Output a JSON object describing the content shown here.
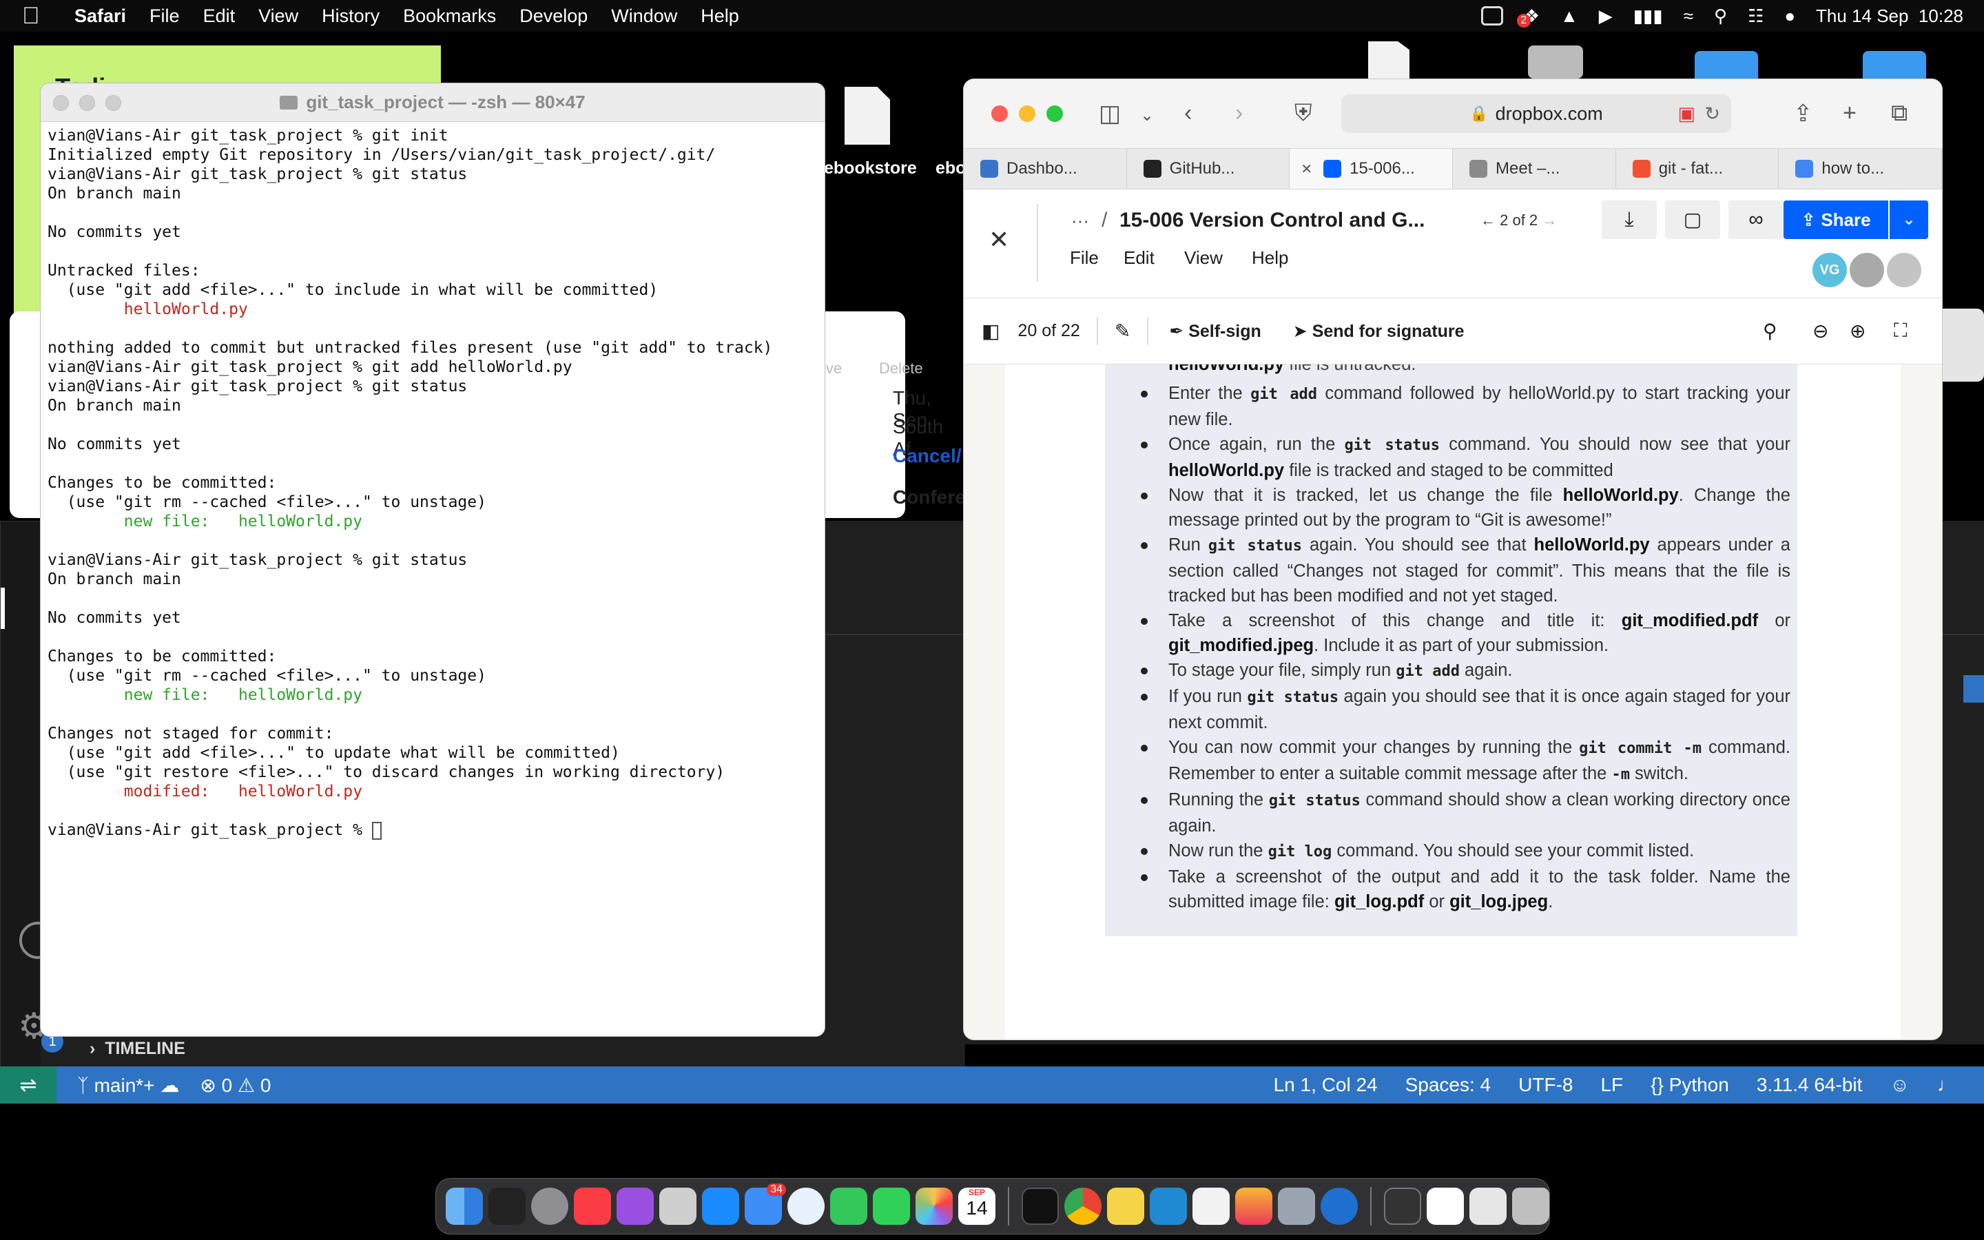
{
  "menubar": {
    "app": "Safari",
    "items": [
      "File",
      "Edit",
      "View",
      "History",
      "Bookmarks",
      "Develop",
      "Window",
      "Help"
    ],
    "badge_count": "2",
    "datetime": "Thu 14 Sep  10:28"
  },
  "desktop": {
    "sticky_text": "Todi",
    "file_label_1": "ebookstore",
    "file_label_2": "ebo"
  },
  "bg_window": {
    "toolbar_1": "ive",
    "toolbar_2": "Delete",
    "line_1": "Thu, Sep",
    "line_2": "South Af",
    "line_3": "Cancel/",
    "line_4": "Confere"
  },
  "vscode": {
    "timeline": "TIMELINE",
    "badge": "1",
    "status": {
      "branch": "main*+",
      "errors": "0",
      "warnings": "0",
      "position": "Ln 1, Col 24",
      "spaces": "Spaces: 4",
      "encoding": "UTF-8",
      "eol": "LF",
      "language": "Python",
      "interpreter": "3.11.4 64-bit"
    }
  },
  "terminal": {
    "title": "git_task_project — -zsh — 80×47",
    "lines": [
      {
        "t": "vian@Vians-Air git_task_project % git init",
        "c": ""
      },
      {
        "t": "Initialized empty Git repository in /Users/vian/git_task_project/.git/",
        "c": ""
      },
      {
        "t": "vian@Vians-Air git_task_project % git status",
        "c": ""
      },
      {
        "t": "On branch main",
        "c": ""
      },
      {
        "t": "",
        "c": ""
      },
      {
        "t": "No commits yet",
        "c": ""
      },
      {
        "t": "",
        "c": ""
      },
      {
        "t": "Untracked files:",
        "c": ""
      },
      {
        "t": "  (use \"git add <file>...\" to include in what will be committed)",
        "c": ""
      },
      {
        "t": "        helloWorld.py",
        "c": "red"
      },
      {
        "t": "",
        "c": ""
      },
      {
        "t": "nothing added to commit but untracked files present (use \"git add\" to track)",
        "c": ""
      },
      {
        "t": "vian@Vians-Air git_task_project % git add helloWorld.py",
        "c": ""
      },
      {
        "t": "vian@Vians-Air git_task_project % git status",
        "c": ""
      },
      {
        "t": "On branch main",
        "c": ""
      },
      {
        "t": "",
        "c": ""
      },
      {
        "t": "No commits yet",
        "c": ""
      },
      {
        "t": "",
        "c": ""
      },
      {
        "t": "Changes to be committed:",
        "c": ""
      },
      {
        "t": "  (use \"git rm --cached <file>...\" to unstage)",
        "c": ""
      },
      {
        "t": "        new file:   helloWorld.py",
        "c": "grn"
      },
      {
        "t": "",
        "c": ""
      },
      {
        "t": "vian@Vians-Air git_task_project % git status",
        "c": ""
      },
      {
        "t": "On branch main",
        "c": ""
      },
      {
        "t": "",
        "c": ""
      },
      {
        "t": "No commits yet",
        "c": ""
      },
      {
        "t": "",
        "c": ""
      },
      {
        "t": "Changes to be committed:",
        "c": ""
      },
      {
        "t": "  (use \"git rm --cached <file>...\" to unstage)",
        "c": ""
      },
      {
        "t": "        new file:   helloWorld.py",
        "c": "grn"
      },
      {
        "t": "",
        "c": ""
      },
      {
        "t": "Changes not staged for commit:",
        "c": ""
      },
      {
        "t": "  (use \"git add <file>...\" to update what will be committed)",
        "c": ""
      },
      {
        "t": "  (use \"git restore <file>...\" to discard changes in working directory)",
        "c": ""
      },
      {
        "t": "        modified:   helloWorld.py",
        "c": "red"
      },
      {
        "t": "",
        "c": ""
      }
    ],
    "prompt": "vian@Vians-Air git_task_project % "
  },
  "safari": {
    "url": "dropbox.com",
    "tabs": [
      {
        "label": "Dashbo...",
        "color": "#3b73c8"
      },
      {
        "label": "GitHub...",
        "color": "#222222"
      },
      {
        "label": "15-006...",
        "color": "#0061fe"
      },
      {
        "label": "Meet –...",
        "color": "#8a8a8a"
      },
      {
        "label": "git - fat...",
        "color": "#f05133"
      },
      {
        "label": "how to...",
        "color": "#4285f4"
      }
    ]
  },
  "dropbox": {
    "breadcrumb_more": "···",
    "breadcrumb_sep": "/",
    "file_title": "15-006 Version Control and G...",
    "version": "2 of 2",
    "menu": [
      "File",
      "Edit",
      "View",
      "Help"
    ],
    "share_label": "Share",
    "avatar": "VG",
    "page_counter": "20 of 22",
    "self_sign": "Self-sign",
    "send_signature": "Send for signature"
  },
  "doc": {
    "cut_b": "helloWorld.py",
    "cut_r": " file is untracked.",
    "b1_a": "Enter the ",
    "b1_m": "git add",
    "b1_b": " command followed by helloWorld.py to start tracking your new file.",
    "b2_a": "Once again, run the ",
    "b2_m": "git status",
    "b2_b": " command. You should now see that your ",
    "b2_c": "helloWorld.py",
    "b2_d": " file is tracked and staged to be committed",
    "b3_a": "Now that it is tracked, let us change the file ",
    "b3_b": "helloWorld.py",
    "b3_c": ". Change the message printed out by the program to “Git is awesome!”",
    "b4_a": "Run ",
    "b4_m": "git status",
    "b4_b": " again. You should see that ",
    "b4_c": "helloWorld.py",
    "b4_d": " appears under a section called “Changes not staged for commit”. This means that the file is tracked but has been modified and not yet staged.",
    "b5_a": "Take a screenshot of this change and title it: ",
    "b5_b": "git_modified.pdf",
    "b5_c": " or ",
    "b5_d": "git_modified.jpeg",
    "b5_e": ". Include it as part of your submission.",
    "b6_a": "To stage your file, simply run ",
    "b6_m": "git add",
    "b6_b": " again.",
    "b7_a": "If you run ",
    "b7_m": "git status",
    "b7_b": " again you should see that it is once again staged for your next commit.",
    "b8_a": "You can now commit your changes by running the ",
    "b8_m": "git commit -m",
    "b8_b": " command. Remember to enter a suitable commit message after the ",
    "b8_m2": "-m",
    "b8_c": " switch.",
    "b9_a": "Running the ",
    "b9_m": "git status",
    "b9_b": " command should show a clean working directory once again.",
    "b10_a": "Now run the ",
    "b10_m": "git log",
    "b10_b": " command. You should see your commit listed.",
    "b11_a": "Take a screenshot of the output and add it to the task folder. Name the submitted image file: ",
    "b11_b": "git_log.pdf",
    "b11_c": " or ",
    "b11_d": "git_log.jpeg",
    "b11_e": "."
  },
  "dock": {
    "mail_badge": "34",
    "calendar_month": "SEP",
    "calendar_day": "14"
  }
}
